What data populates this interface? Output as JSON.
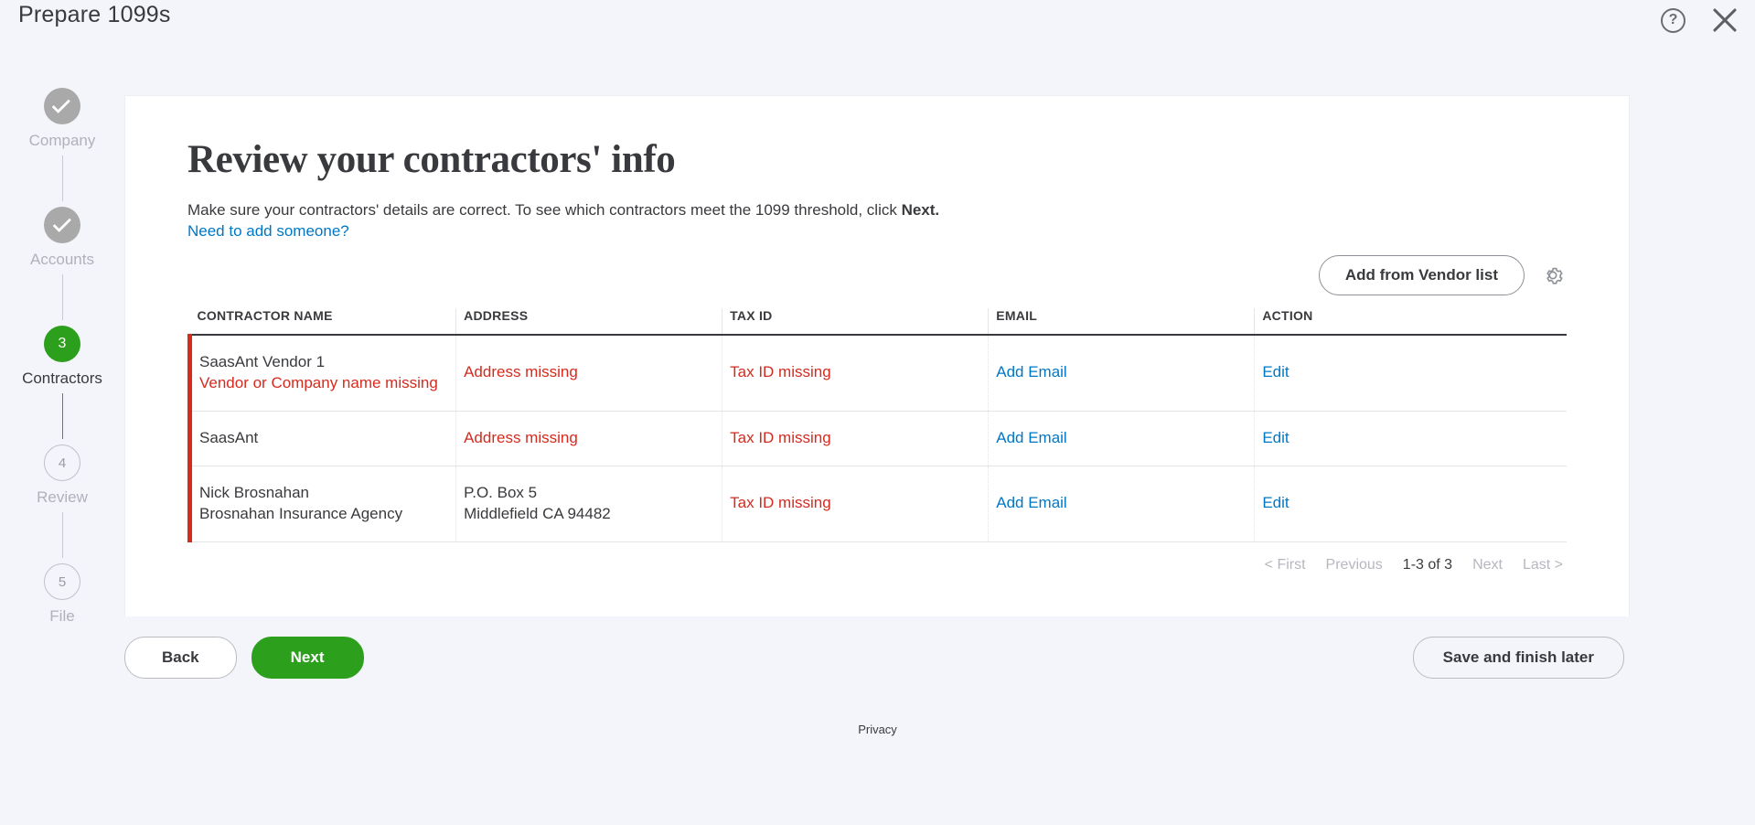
{
  "window": {
    "title": "Prepare 1099s",
    "help_icon": "help-circle-icon",
    "close_icon": "close-icon"
  },
  "stepper": {
    "steps": [
      {
        "index": "1",
        "label": "Company",
        "state": "done"
      },
      {
        "index": "2",
        "label": "Accounts",
        "state": "done"
      },
      {
        "index": "3",
        "label": "Contractors",
        "state": "current"
      },
      {
        "index": "4",
        "label": "Review",
        "state": "todo"
      },
      {
        "index": "5",
        "label": "File",
        "state": "todo"
      }
    ]
  },
  "main": {
    "title": "Review your contractors' info",
    "lede_part1": "Make sure your contractors' details are correct. To see which contractors meet the 1099 threshold, click ",
    "lede_bold": "Next.",
    "add_someone_link": "Need to add someone?",
    "add_vendor_button": "Add from Vendor list",
    "gear_icon": "gear-icon"
  },
  "table": {
    "columns": [
      "CONTRACTOR NAME",
      "ADDRESS",
      "TAX ID",
      "EMAIL",
      "ACTION"
    ],
    "rows": [
      {
        "name": "SaasAnt Vendor 1",
        "name_sub": "Vendor or Company name missing",
        "name_sub_error": true,
        "address_line1": "Address missing",
        "address_line2": "",
        "address_error": true,
        "tax_id": "Tax ID missing",
        "tax_id_error": true,
        "email": "Add Email",
        "action": "Edit"
      },
      {
        "name": "SaasAnt",
        "name_sub": "",
        "name_sub_error": false,
        "address_line1": "Address missing",
        "address_line2": "",
        "address_error": true,
        "tax_id": "Tax ID missing",
        "tax_id_error": true,
        "email": "Add Email",
        "action": "Edit"
      },
      {
        "name": "Nick Brosnahan",
        "name_sub": "Brosnahan Insurance Agency",
        "name_sub_error": false,
        "address_line1": "P.O. Box 5",
        "address_line2": "Middlefield CA 94482",
        "address_error": false,
        "tax_id": "Tax ID missing",
        "tax_id_error": true,
        "email": "Add Email",
        "action": "Edit"
      }
    ]
  },
  "pagination": {
    "first": "< First",
    "previous": "Previous",
    "current": "1-3 of 3",
    "next": "Next",
    "last": "Last >"
  },
  "footer": {
    "back": "Back",
    "next": "Next",
    "save_later": "Save and finish later"
  },
  "privacy": "Privacy",
  "colors": {
    "brand_green": "#2ca01c",
    "link_blue": "#0077c5",
    "error_red": "#d52b1e",
    "page_bg": "#f4f5fb",
    "text": "#393a3d"
  }
}
